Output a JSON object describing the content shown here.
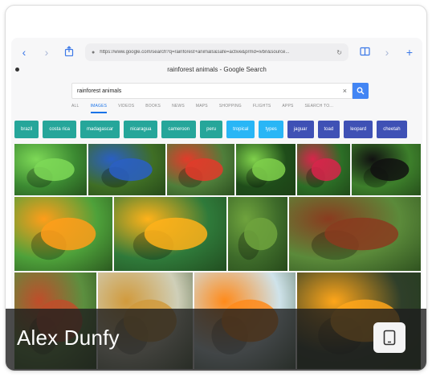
{
  "browser": {
    "url": "https://www.google.com/search?q=rainforest+animals&safe=active&prmd=ivbn&source...",
    "page_title": "rainforest animals - Google Search"
  },
  "search": {
    "query": "rainforest animals"
  },
  "tabs": [
    {
      "label": "ALL",
      "active": false
    },
    {
      "label": "IMAGES",
      "active": true
    },
    {
      "label": "VIDEOS",
      "active": false
    },
    {
      "label": "BOOKS",
      "active": false
    },
    {
      "label": "NEWS",
      "active": false
    },
    {
      "label": "MAPS",
      "active": false
    },
    {
      "label": "SHOPPING",
      "active": false
    },
    {
      "label": "FLIGHTS",
      "active": false
    },
    {
      "label": "APPS",
      "active": false
    },
    {
      "label": "SEARCH TO...",
      "active": false
    }
  ],
  "chips": [
    {
      "label": "brazil",
      "color": "#26a69a"
    },
    {
      "label": "costa rica",
      "color": "#26a69a"
    },
    {
      "label": "madagascar",
      "color": "#26a69a"
    },
    {
      "label": "nicaragua",
      "color": "#26a69a"
    },
    {
      "label": "cameroon",
      "color": "#26a69a"
    },
    {
      "label": "peru",
      "color": "#26a69a"
    },
    {
      "label": "tropical",
      "color": "#29b6f6"
    },
    {
      "label": "types",
      "color": "#29b6f6"
    },
    {
      "label": "jaguar",
      "color": "#3f51b5"
    },
    {
      "label": "toad",
      "color": "#3f51b5"
    },
    {
      "label": "leopard",
      "color": "#3f51b5"
    },
    {
      "label": "cheetah",
      "color": "#3f51b5"
    }
  ],
  "images": [
    {
      "subject": "red-eyed tree frog",
      "bg": "#3c8a32",
      "fg": "#7ed957"
    },
    {
      "subject": "blue poison dart frog",
      "bg": "#3f6e25",
      "fg": "#2a5fc4"
    },
    {
      "subject": "macaw",
      "bg": "#4f7e3a",
      "fg": "#e23b2a"
    },
    {
      "subject": "tree frog on leaf",
      "bg": "#1f4d1a",
      "fg": "#7fd04b"
    },
    {
      "subject": "tree frog on red flower",
      "bg": "#2c6e26",
      "fg": "#d8254b"
    },
    {
      "subject": "dark frog",
      "bg": "#3d7f2b",
      "fg": "#111111"
    },
    {
      "subject": "toucan",
      "bg": "#4ea13a",
      "fg": "#ff9d1a"
    },
    {
      "subject": "toucan close up",
      "bg": "#2f7a3a",
      "fg": "#ffb21a"
    },
    {
      "subject": "chameleon",
      "bg": "#3e6b2a",
      "fg": "#6fa33d"
    },
    {
      "subject": "tree kangaroo",
      "bg": "#5b8a3a",
      "fg": "#8a3b1f"
    },
    {
      "subject": "rainforest collage",
      "bg": "#5c8f3f",
      "fg": "#c04d2a"
    },
    {
      "subject": "jaguar",
      "bg": "#cfcfb8",
      "fg": "#d19a3c"
    },
    {
      "subject": "toucan on branch",
      "bg": "#cfe3ea",
      "fg": "#ff8a1a"
    },
    {
      "subject": "toucan profile",
      "bg": "#2f3f2a",
      "fg": "#ffa61a"
    }
  ],
  "author": {
    "name": "Alex Dunfy"
  }
}
